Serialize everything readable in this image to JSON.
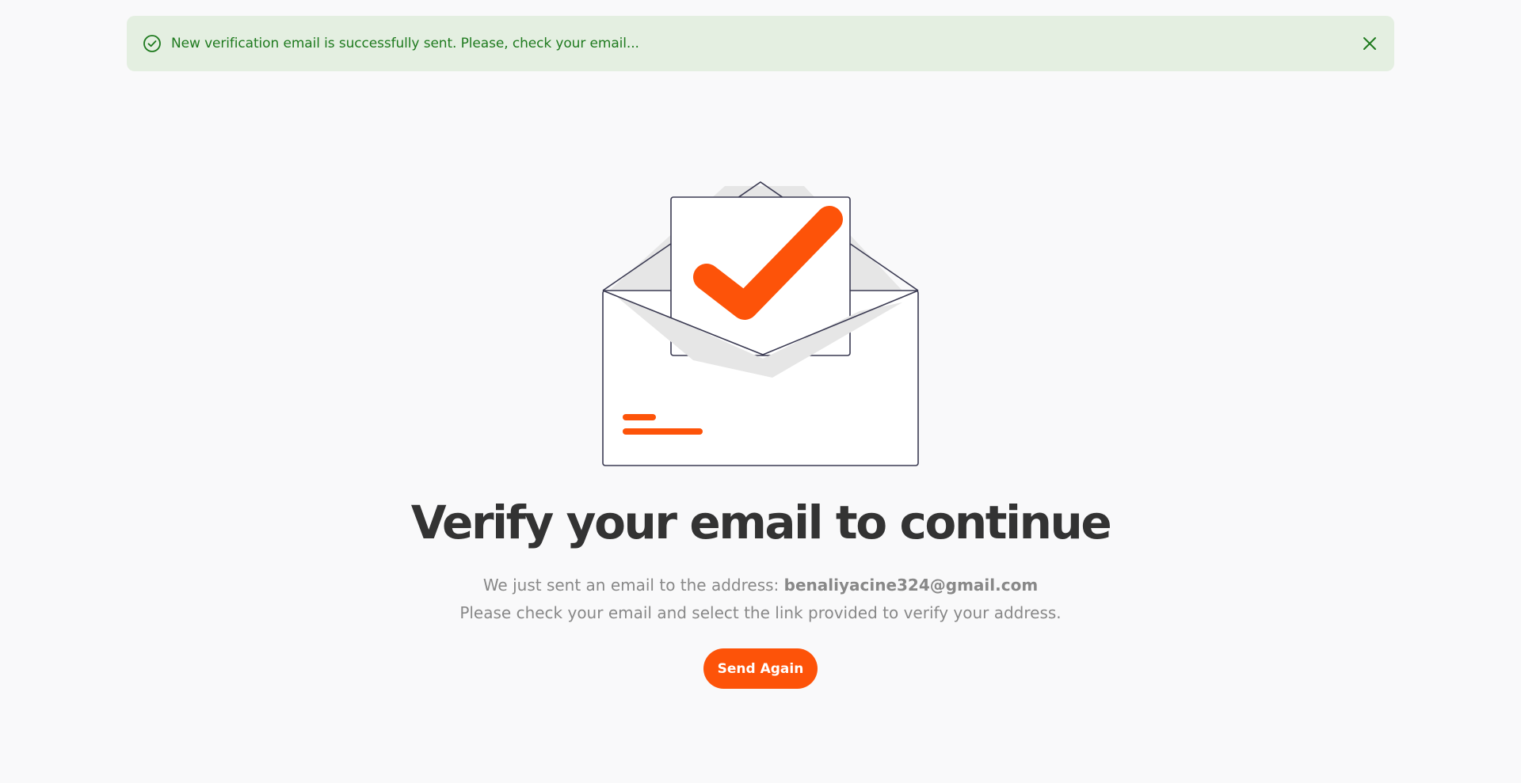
{
  "alert": {
    "message": "New verification email is successfully sent. Please, check your email...",
    "status_icon": "check-circle-icon",
    "close_icon": "close-icon",
    "color": "#1e7a1e",
    "background": "#e4efe1"
  },
  "illustration": {
    "icon": "envelope-check-icon",
    "accent_color": "#fd5309"
  },
  "heading": "Verify your email to continue",
  "description": {
    "line1_prefix": "We just sent an email to the address: ",
    "email": "benaliyacine324@gmail.com",
    "line2": "Please check your email and select the link provided to verify your address."
  },
  "send_again_button": {
    "label": "Send Again",
    "color": "#fd5309"
  }
}
